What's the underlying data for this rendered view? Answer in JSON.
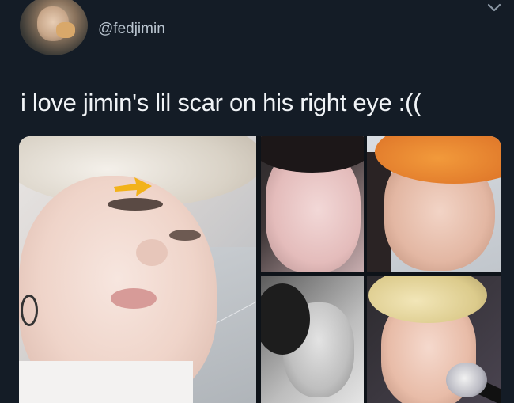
{
  "tweet": {
    "handle": "@fedjimin",
    "text": "i love jimin's lil scar on his right eye :((",
    "avatar_icon": "profile-photo",
    "more_icon": "chevron-down-icon"
  },
  "media": {
    "photo_count": 5,
    "annotation_icon": "arrow-pointer-icon",
    "arrow_color": "#f2b21a"
  },
  "colors": {
    "background": "#141c26",
    "text": "#f1f4f7",
    "secondary_text": "#b9c4cf"
  }
}
